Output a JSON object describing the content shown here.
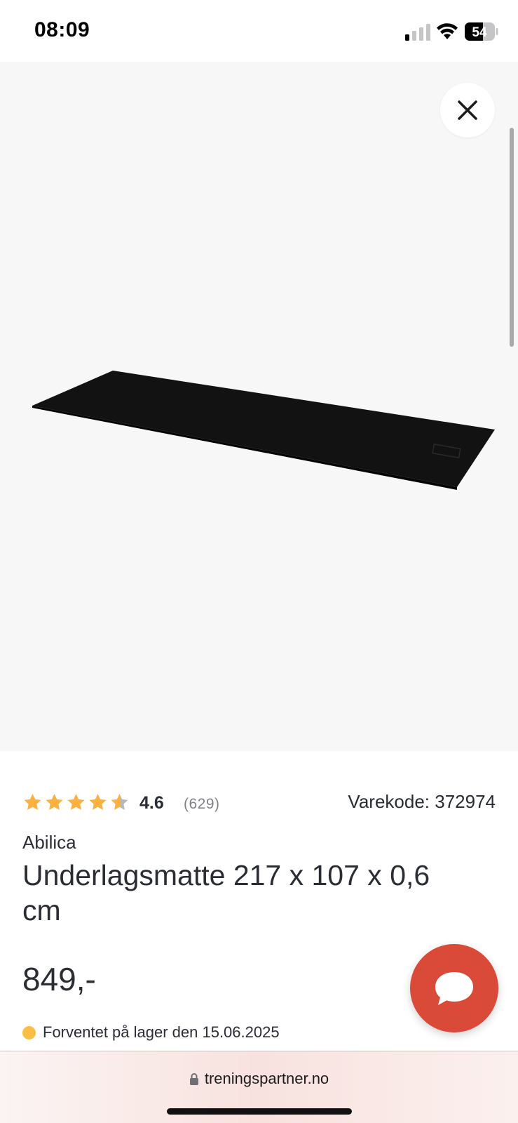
{
  "status_bar": {
    "time": "08:09",
    "battery_level": "54",
    "icons": [
      "signal-icon",
      "wifi-icon",
      "battery-icon"
    ]
  },
  "gallery": {
    "close_icon": "close-icon",
    "product_image": "black floor mat"
  },
  "product": {
    "rating": {
      "value": "4.6",
      "count": "(629)",
      "stars": 4.6,
      "star_color": "#fbb040"
    },
    "sku_label": "Varekode: 372974",
    "brand": "Abilica",
    "title": "Underlagsmatte 217 x 107 x 0,6 cm",
    "price": "849,-",
    "stock": {
      "status_color": "#fbbe44",
      "text": "Forventet på lager den 15.06.2025"
    }
  },
  "chat": {
    "icon": "chat-bubble-icon",
    "color": "#d94a38"
  },
  "browser": {
    "url": "treningspartner.no",
    "lock_icon": "lock-icon"
  }
}
